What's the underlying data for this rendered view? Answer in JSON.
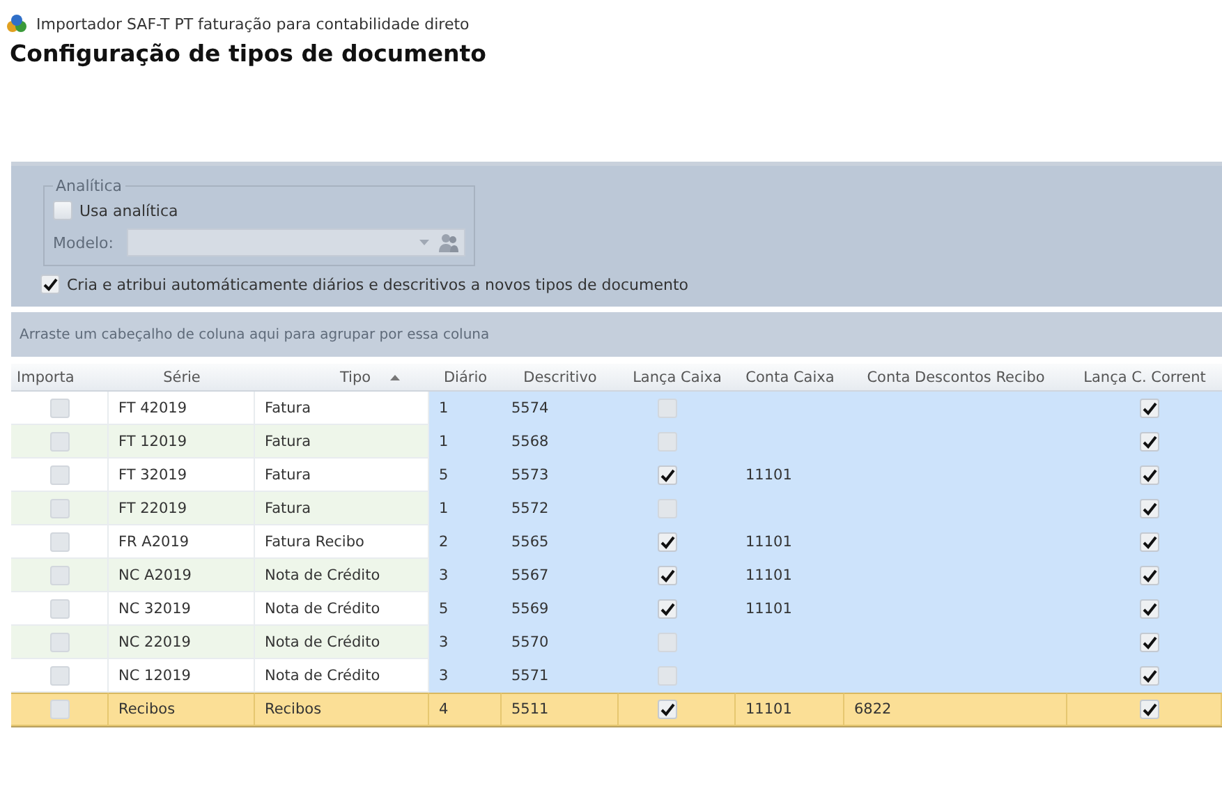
{
  "window": {
    "title": "Importador SAF-T PT faturação para contabilidade direto"
  },
  "heading": "Configuração de tipos de documento",
  "options": {
    "group_title": "Analítica",
    "use_analytics": {
      "label": "Usa analítica",
      "checked": false
    },
    "model": {
      "label": "Modelo:",
      "disabled": true
    },
    "auto_create": {
      "label": "Cria e atribui automáticamente diários e descritivos a novos tipos de documento",
      "checked": true
    }
  },
  "group_panel": {
    "placeholder": "Arraste um cabeçalho de coluna aqui para agrupar por essa coluna"
  },
  "table": {
    "columns": [
      {
        "label": "Importa"
      },
      {
        "label": "Série"
      },
      {
        "label": "Tipo",
        "sorted": true
      },
      {
        "label": "Diário"
      },
      {
        "label": "Descritivo"
      },
      {
        "label": "Lança Caixa"
      },
      {
        "label": "Conta Caixa"
      },
      {
        "label": "Conta Descontos Recibo"
      },
      {
        "label": "Lança C. Corrent"
      }
    ],
    "rows": [
      {
        "importa": false,
        "serie": "FT 42019",
        "tipo": "Fatura",
        "diario": "1",
        "descritivo": "5574",
        "lanca_caixa": false,
        "conta_caixa": "",
        "conta_descontos": "",
        "lanca_cc": true,
        "selected": false
      },
      {
        "importa": false,
        "serie": "FT 12019",
        "tipo": "Fatura",
        "diario": "1",
        "descritivo": "5568",
        "lanca_caixa": false,
        "conta_caixa": "",
        "conta_descontos": "",
        "lanca_cc": true,
        "selected": false
      },
      {
        "importa": false,
        "serie": "FT 32019",
        "tipo": "Fatura",
        "diario": "5",
        "descritivo": "5573",
        "lanca_caixa": true,
        "conta_caixa": "11101",
        "conta_descontos": "",
        "lanca_cc": true,
        "selected": false
      },
      {
        "importa": false,
        "serie": "FT 22019",
        "tipo": "Fatura",
        "diario": "1",
        "descritivo": "5572",
        "lanca_caixa": false,
        "conta_caixa": "",
        "conta_descontos": "",
        "lanca_cc": true,
        "selected": false
      },
      {
        "importa": false,
        "serie": "FR A2019",
        "tipo": "Fatura Recibo",
        "diario": "2",
        "descritivo": "5565",
        "lanca_caixa": true,
        "conta_caixa": "11101",
        "conta_descontos": "",
        "lanca_cc": true,
        "selected": false
      },
      {
        "importa": false,
        "serie": "NC A2019",
        "tipo": "Nota de Crédito",
        "diario": "3",
        "descritivo": "5567",
        "lanca_caixa": true,
        "conta_caixa": "11101",
        "conta_descontos": "",
        "lanca_cc": true,
        "selected": false
      },
      {
        "importa": false,
        "serie": "NC 32019",
        "tipo": "Nota de Crédito",
        "diario": "5",
        "descritivo": "5569",
        "lanca_caixa": true,
        "conta_caixa": "11101",
        "conta_descontos": "",
        "lanca_cc": true,
        "selected": false
      },
      {
        "importa": false,
        "serie": "NC 22019",
        "tipo": "Nota de Crédito",
        "diario": "3",
        "descritivo": "5570",
        "lanca_caixa": false,
        "conta_caixa": "",
        "conta_descontos": "",
        "lanca_cc": true,
        "selected": false
      },
      {
        "importa": false,
        "serie": "NC 12019",
        "tipo": "Nota de Crédito",
        "diario": "3",
        "descritivo": "5571",
        "lanca_caixa": false,
        "conta_caixa": "",
        "conta_descontos": "",
        "lanca_cc": true,
        "selected": false
      },
      {
        "importa": false,
        "serie": "Recibos",
        "tipo": "Recibos",
        "diario": "4",
        "descritivo": "5511",
        "lanca_caixa": true,
        "conta_caixa": "11101",
        "conta_descontos": "6822",
        "lanca_cc": true,
        "selected": true
      }
    ]
  }
}
